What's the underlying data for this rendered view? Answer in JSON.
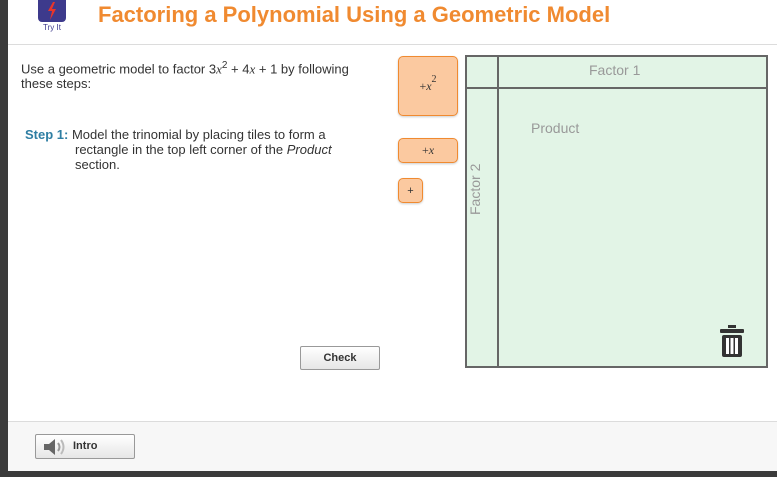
{
  "header": {
    "logo_label": "Try It",
    "title": "Factoring a Polynomial Using a Geometric Model",
    "title_color": "#f08a30"
  },
  "instructions": {
    "text_before": "Use a geometric model to factor 3",
    "var1": "x",
    "exp": "2",
    "text_middle": " + 4",
    "var2": "x",
    "text_after": " + 1 by following these steps:"
  },
  "step1": {
    "label": "Step 1:",
    "text_line1": "Model the trinomial by placing tiles to form a",
    "text_line2_before": "rectangle in the top left corner of the ",
    "text_line2_italic": "Product",
    "text_line3": "section."
  },
  "tiles": {
    "x_squared_prefix": "+",
    "x_squared_var": "x",
    "x_squared_exp": "2",
    "x_prefix": "+",
    "x_var": "x",
    "one_label": "+"
  },
  "workspace": {
    "factor1_label": "Factor 1",
    "factor2_label": "Factor 2",
    "product_label": "Product",
    "background_color": "#e2f4e6"
  },
  "buttons": {
    "check_label": "Check",
    "intro_label": "Intro"
  },
  "icons": {
    "logo": "lightning-icon",
    "trash": "trash-icon",
    "intro": "speaker-icon"
  }
}
